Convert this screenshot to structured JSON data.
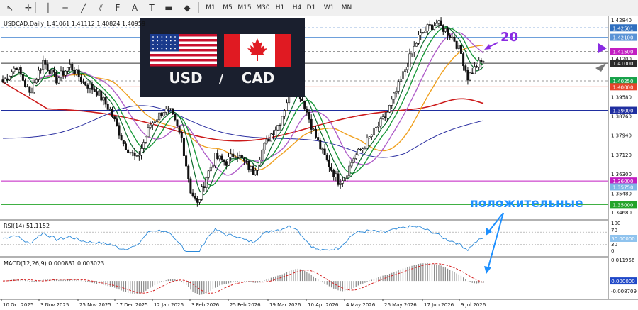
{
  "toolbar": {
    "tools": [
      {
        "icon": "cursor-arrow-icon",
        "glyph": "↖"
      },
      {
        "icon": "crosshair-icon",
        "glyph": "✛"
      },
      {
        "icon": "vertical-line-icon",
        "glyph": "│"
      },
      {
        "icon": "horizontal-line-icon",
        "glyph": "─"
      },
      {
        "icon": "trendline-icon",
        "glyph": "╱"
      },
      {
        "icon": "channel-icon",
        "glyph": "⫽"
      },
      {
        "icon": "fibonacci-icon",
        "glyph": "F"
      },
      {
        "icon": "text-icon",
        "glyph": "A"
      },
      {
        "icon": "label-icon",
        "glyph": "T"
      },
      {
        "icon": "rectangle-icon",
        "glyph": "▬"
      },
      {
        "icon": "shapes-dropdown-icon",
        "glyph": "◆"
      }
    ],
    "timeframes": [
      "M1",
      "M5",
      "M15",
      "M30",
      "H1",
      "H4",
      "D1",
      "W1",
      "MN"
    ]
  },
  "header": {
    "symbol": "USDCAD,Daily",
    "ohlc": "1.41061 1.41112 1.40824 1.40959"
  },
  "banner": {
    "left": "USD",
    "sep": "/",
    "right": "CAD",
    "flags": [
      "us-flag-icon",
      "canada-flag-icon"
    ]
  },
  "annotations": {
    "ma_period": "20",
    "positive_text": "положительные",
    "accent_color": "#8a2be2",
    "positive_color": "#1e90ff"
  },
  "main_axis": {
    "labels": [
      {
        "text": "1.42840",
        "v": 1.4284,
        "mark": null
      },
      {
        "text": "1.42501",
        "v": 1.42501,
        "mark": "#2f6fbf"
      },
      {
        "text": "1.42100",
        "v": 1.421,
        "mark": "#5a93d6"
      },
      {
        "text": "1.41500",
        "v": 1.415,
        "mark": "#c21ec2"
      },
      {
        "text": "1.41200",
        "v": 1.412,
        "mark": null
      },
      {
        "text": "1.41000",
        "v": 1.41,
        "mark": "#2a2a2a"
      },
      {
        "text": "1.40250",
        "v": 1.4025,
        "mark": "#17a24a"
      },
      {
        "text": "1.40000",
        "v": 1.4,
        "mark": "#e8432b"
      },
      {
        "text": "1.39580",
        "v": 1.3958,
        "mark": null
      },
      {
        "text": "1.39000",
        "v": 1.39,
        "mark": "#1f2ea0"
      },
      {
        "text": "1.38760",
        "v": 1.3876,
        "mark": null
      },
      {
        "text": "1.37940",
        "v": 1.3794,
        "mark": null
      },
      {
        "text": "1.37120",
        "v": 1.3712,
        "mark": null
      },
      {
        "text": "1.36300",
        "v": 1.363,
        "mark": null
      },
      {
        "text": "1.36000",
        "v": 1.36,
        "mark": "#c21ec2"
      },
      {
        "text": "1.35750",
        "v": 1.3575,
        "mark": "#7fb7e6"
      },
      {
        "text": "1.35480",
        "v": 1.3548,
        "mark": null
      },
      {
        "text": "1.35000",
        "v": 1.35,
        "mark": "#24a42a"
      },
      {
        "text": "1.34680",
        "v": 1.3468,
        "mark": null
      }
    ],
    "levels": [
      {
        "v": 1.42501,
        "color": "#2f6fbf",
        "dash": "3,3"
      },
      {
        "v": 1.421,
        "color": "#5a93d6",
        "dash": ""
      },
      {
        "v": 1.415,
        "color": "#999999",
        "dash": "3,3"
      },
      {
        "v": 1.41,
        "color": "#333333",
        "dash": ""
      },
      {
        "v": 1.4025,
        "color": "#999999",
        "dash": "3,3"
      },
      {
        "v": 1.4,
        "color": "#e8432b",
        "dash": ""
      },
      {
        "v": 1.39,
        "color": "#1f2ea0",
        "dash": ""
      },
      {
        "v": 1.36,
        "color": "#c21ec2",
        "dash": ""
      },
      {
        "v": 1.3575,
        "color": "#999999",
        "dash": "3,3"
      },
      {
        "v": 1.35,
        "color": "#24a42a",
        "dash": ""
      }
    ]
  },
  "rsi": {
    "label": "RSI(14) 51.1152",
    "ticks": [
      "100",
      "70",
      "30",
      "0"
    ],
    "tag": "50.00000"
  },
  "macd": {
    "label": "MACD(12,26,9) 0.000881 0.003023",
    "ticks": [
      "0.011956",
      "0.000000",
      "-0.008709"
    ]
  },
  "date_labels": [
    "10 Oct 2025",
    "3 Nov 2025",
    "25 Nov 2025",
    "17 Dec 2025",
    "12 Jan 2026",
    "3 Feb 2026",
    "25 Feb 2026",
    "19 Mar 2026",
    "10 Apr 2026",
    "4 May 2026",
    "26 May 2026",
    "17 Jun 2026",
    "9 Jul 2026"
  ],
  "chart_data": {
    "type": "candlestick",
    "symbol": "USDCAD",
    "timeframe": "Daily",
    "ylim": [
      1.3468,
      1.4284
    ],
    "price_path_anchors": [
      [
        0,
        1.402
      ],
      [
        6,
        1.409
      ],
      [
        12,
        1.397
      ],
      [
        18,
        1.411
      ],
      [
        24,
        1.403
      ],
      [
        30,
        1.409
      ],
      [
        36,
        1.402
      ],
      [
        42,
        1.398
      ],
      [
        48,
        1.39
      ],
      [
        54,
        1.376
      ],
      [
        60,
        1.369
      ],
      [
        66,
        1.384
      ],
      [
        72,
        1.39
      ],
      [
        75,
        1.389
      ],
      [
        80,
        1.378
      ],
      [
        84,
        1.356
      ],
      [
        87,
        1.35
      ],
      [
        91,
        1.362
      ],
      [
        95,
        1.37
      ],
      [
        100,
        1.368
      ],
      [
        104,
        1.372
      ],
      [
        108,
        1.368
      ],
      [
        112,
        1.364
      ],
      [
        116,
        1.373
      ],
      [
        120,
        1.38
      ],
      [
        124,
        1.385
      ],
      [
        128,
        1.397
      ],
      [
        131,
        1.401
      ],
      [
        135,
        1.392
      ],
      [
        139,
        1.381
      ],
      [
        143,
        1.372
      ],
      [
        147,
        1.365
      ],
      [
        150,
        1.36
      ],
      [
        153,
        1.362
      ],
      [
        157,
        1.37
      ],
      [
        161,
        1.374
      ],
      [
        166,
        1.381
      ],
      [
        171,
        1.387
      ],
      [
        176,
        1.398
      ],
      [
        181,
        1.41
      ],
      [
        186,
        1.421
      ],
      [
        190,
        1.425
      ],
      [
        194,
        1.427
      ],
      [
        198,
        1.424
      ],
      [
        202,
        1.42
      ],
      [
        205,
        1.414
      ],
      [
        208,
        1.404
      ],
      [
        212,
        1.409
      ],
      [
        215,
        1.411
      ]
    ],
    "ma_overlays": [
      {
        "name": "MA red (200)",
        "color": "#cc1a1a"
      },
      {
        "name": "MA blue",
        "color": "#2a2ea0"
      },
      {
        "name": "MA orange",
        "color": "#f0a01e"
      },
      {
        "name": "MA violet (20)",
        "color": "#b05ec9"
      },
      {
        "name": "MA green",
        "color": "#1a9a3a"
      },
      {
        "name": "MA dark green",
        "color": "#0b6a2a"
      }
    ],
    "rsi_value": 51.1152,
    "macd_main": 0.000881,
    "macd_signal": 0.003023
  }
}
